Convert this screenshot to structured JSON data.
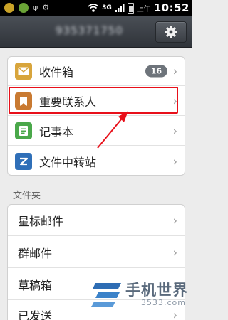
{
  "status_bar": {
    "network": "3G",
    "ampm": "上午",
    "time": "10:52",
    "icons": [
      "notification-icon",
      "usb-icon",
      "wifi-icon",
      "signal-icon",
      "battery-icon"
    ]
  },
  "header": {
    "account": "935371750",
    "settings_icon": "gear-icon"
  },
  "main_list": [
    {
      "label": "收件箱",
      "icon": "envelope-icon",
      "badge": "16",
      "color": "#d8a53c"
    },
    {
      "label": "重要联系人",
      "icon": "bookmark-icon",
      "color": "#c97a32"
    },
    {
      "label": "记事本",
      "icon": "notepad-icon",
      "color": "#4aa84a"
    },
    {
      "label": "文件中转站",
      "icon": "transfer-icon",
      "color": "#2f6fb8"
    }
  ],
  "section_label": "文件夹",
  "folders": [
    {
      "label": "星标邮件"
    },
    {
      "label": "群邮件"
    },
    {
      "label": "草稿箱"
    },
    {
      "label": "已发送"
    }
  ],
  "watermark": {
    "brand": "手机世界",
    "sub": "3533.com"
  },
  "highlight_color": "#e8101a"
}
